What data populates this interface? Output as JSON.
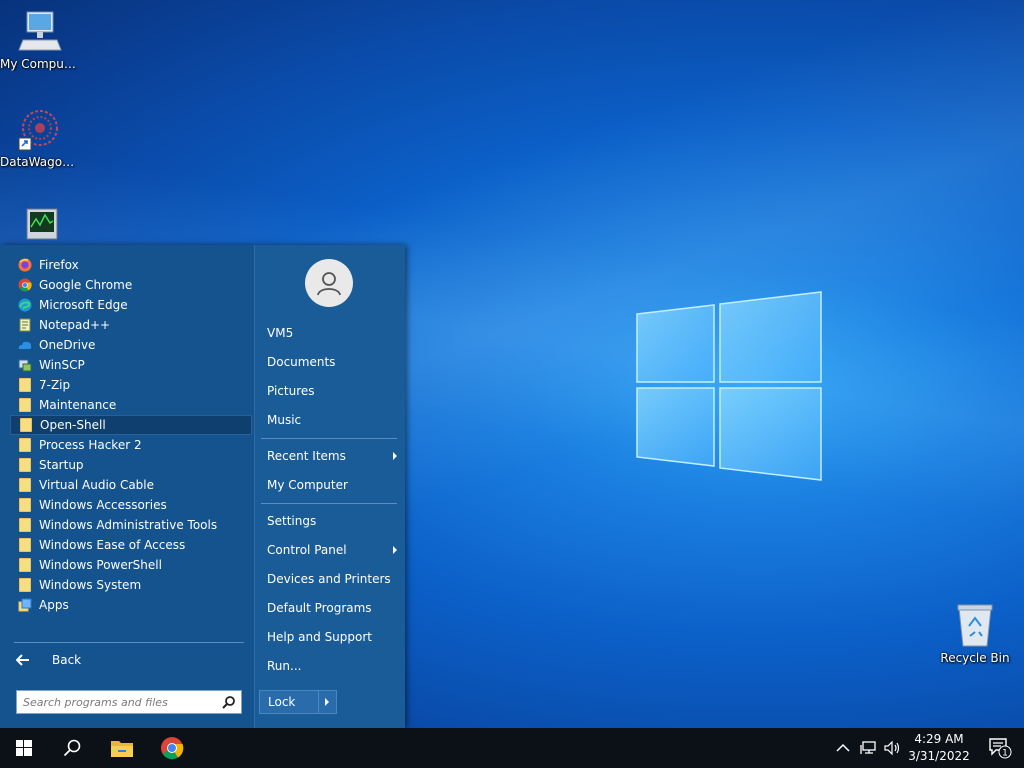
{
  "desktop": {
    "icons": [
      {
        "label": "My Computer",
        "icon": "my-computer-icon"
      },
      {
        "label": "DataWagon...",
        "icon": "datawagon-icon"
      },
      {
        "label": "",
        "icon": "monitoring-app-icon"
      },
      {
        "label": "Recycle Bin",
        "icon": "recycle-bin-icon"
      }
    ]
  },
  "start_menu": {
    "programs": [
      {
        "label": "Firefox",
        "icon": "firefox-icon"
      },
      {
        "label": "Google Chrome",
        "icon": "chrome-icon"
      },
      {
        "label": "Microsoft Edge",
        "icon": "edge-icon"
      },
      {
        "label": "Notepad++",
        "icon": "notepadpp-icon"
      },
      {
        "label": "OneDrive",
        "icon": "onedrive-icon"
      },
      {
        "label": "WinSCP",
        "icon": "winscp-icon"
      },
      {
        "label": "7-Zip",
        "icon": "folder-icon"
      },
      {
        "label": "Maintenance",
        "icon": "folder-icon"
      },
      {
        "label": "Open-Shell",
        "icon": "folder-icon",
        "selected": true
      },
      {
        "label": "Process Hacker 2",
        "icon": "folder-icon"
      },
      {
        "label": "Startup",
        "icon": "folder-icon"
      },
      {
        "label": "Virtual Audio Cable",
        "icon": "folder-icon"
      },
      {
        "label": "Windows Accessories",
        "icon": "folder-icon"
      },
      {
        "label": "Windows Administrative Tools",
        "icon": "folder-icon"
      },
      {
        "label": "Windows Ease of Access",
        "icon": "folder-icon"
      },
      {
        "label": "Windows PowerShell",
        "icon": "folder-icon"
      },
      {
        "label": "Windows System",
        "icon": "folder-icon"
      },
      {
        "label": "Apps",
        "icon": "apps-icon"
      }
    ],
    "back_label": "Back",
    "search_placeholder": "Search programs and files",
    "right_items": {
      "user": "VM5",
      "documents": "Documents",
      "pictures": "Pictures",
      "music": "Music",
      "recent_items": "Recent Items",
      "my_computer": "My Computer",
      "settings": "Settings",
      "control_panel": "Control Panel",
      "devices_printers": "Devices and Printers",
      "default_programs": "Default Programs",
      "help_support": "Help and Support",
      "run": "Run..."
    },
    "lock_label": "Lock"
  },
  "taskbar": {
    "time": "4:29 AM",
    "date": "3/31/2022",
    "notification_count": "1"
  }
}
